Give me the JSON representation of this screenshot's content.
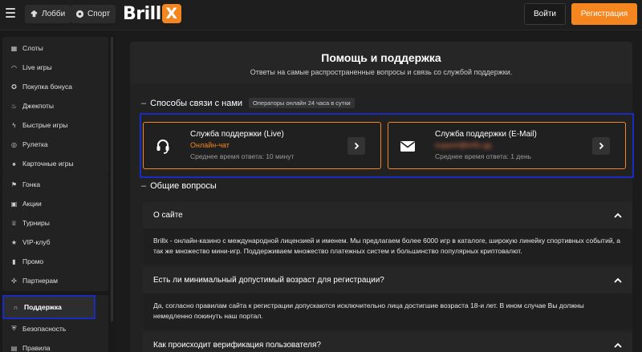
{
  "header": {
    "lobby_label": "Лобби",
    "sport_label": "Спорт",
    "logo_text": "Brill",
    "logo_x": "X",
    "login_label": "Войти",
    "register_label": "Регистрация",
    "accent_color": "#f5861f"
  },
  "sidebar": {
    "group1": [
      {
        "label": "Слоты",
        "icon": "slot-icon"
      },
      {
        "label": "Live игры",
        "icon": "headphones-icon"
      },
      {
        "label": "Покупка бонуса",
        "icon": "bonus-icon"
      },
      {
        "label": "Джекпоты",
        "icon": "fire-icon"
      },
      {
        "label": "Быстрые игры",
        "icon": "lightning-icon"
      },
      {
        "label": "Рулетка",
        "icon": "roulette-icon"
      },
      {
        "label": "Карточные игры",
        "icon": "cards-icon"
      }
    ],
    "group2": [
      {
        "label": "Гонка",
        "icon": "flag-icon"
      },
      {
        "label": "Акции",
        "icon": "gift-icon"
      },
      {
        "label": "Турниры",
        "icon": "trophy-icon"
      },
      {
        "label": "VIP-клуб",
        "icon": "star-icon"
      },
      {
        "label": "Промо",
        "icon": "promo-icon"
      },
      {
        "label": "Партнерам",
        "icon": "partners-icon"
      }
    ],
    "group3": [
      {
        "label": "Поддержка",
        "icon": "support-icon",
        "active": true
      },
      {
        "label": "Безопасность",
        "icon": "shield-icon"
      },
      {
        "label": "Правила",
        "icon": "rules-icon"
      }
    ]
  },
  "main": {
    "title": "Помощь и поддержка",
    "subtitle": "Ответы на самые распространенные вопросы и связь со службой поддержки.",
    "contact_section": {
      "title": "Способы связи с нами",
      "badge": "Операторы онлайн 24 часа в сутки",
      "cards": [
        {
          "title": "Служба поддержки (Live)",
          "status": "Онлайн-чат",
          "meta": "Среднее время ответа: 10 минут",
          "icon": "headset-icon"
        },
        {
          "title": "Служба поддержки (E-Mail)",
          "status": "support@brillx.gg",
          "meta": "Среднее время ответа: 1 день",
          "icon": "mail-icon"
        }
      ]
    },
    "faq_section": {
      "title": "Общие вопросы",
      "items": [
        {
          "question": "О сайте",
          "answer": "Brillx - онлайн-казино с международной лицензией и именем. Мы предлагаем более 6000 игр в каталоге, широкую линейку спортивных событий, а так же множество мини-игр. Поддерживаем множество платежных систем и большинство популярных криптовалют."
        },
        {
          "question": "Есть ли минимальный допустимый возраст для регистрации?",
          "answer": "Да, согласно правилам сайта к регистрации допускаются исключительно лица достигшие возраста 18-и лет. В ином случае Вы должны немедленно покинуть наш портал."
        },
        {
          "question": "Как происходит верификация пользователя?",
          "answer": ""
        }
      ]
    }
  }
}
